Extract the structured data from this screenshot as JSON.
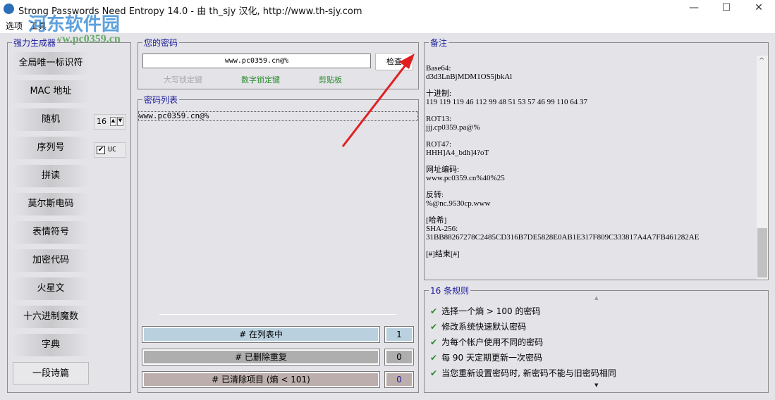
{
  "window": {
    "title": "Strong Passwords Need Entropy 14.0 - 由 th_sjy 汉化, http://www.th-sjy.com",
    "minimize": "—",
    "maximize": "☐",
    "close": "✕"
  },
  "watermark": {
    "name": "河东软件园",
    "url": "www.pc0359.cn"
  },
  "menu": [
    "选项",
    "工具"
  ],
  "generator": {
    "title": "强力生成器",
    "buttons": [
      "全局唯一标识符",
      "MAC 地址",
      "随机",
      "序列号",
      "拼读",
      "莫尔斯电码",
      "表情符号",
      "加密代码",
      "火星文",
      "十六进制魔数",
      "字典",
      "一段诗篇"
    ],
    "length": "16",
    "uc_label": "UC",
    "uc_checked": true
  },
  "password": {
    "title": "您的密码",
    "value": "www.pc0359.cn@%",
    "check": "检查",
    "caps": "大写锁定键",
    "num": "数字锁定键",
    "clip": "剪贴板"
  },
  "list": {
    "title": "密码列表",
    "items": [
      "www.pc0359.cn@%"
    ],
    "stats": [
      {
        "label": "# 在列表中",
        "count": "1"
      },
      {
        "label": "# 已删除重复",
        "count": "0"
      },
      {
        "label": "# 已清除项目 (熵 < 101)",
        "count": "0"
      }
    ]
  },
  "notes": {
    "title": "备注",
    "text": "Base64:\nd3d3LnBjMDM1OS5jbkAl\n\n十进制:\n119 119 119 46 112 99 48 51 53 57 46 99 110 64 37\n\nROT13:\njjj.cp0359.pa@%\n\nROT47:\nHHH]A4_bdh]4?oT\n\n网址编码:\nwww.pc0359.cn%40%25\n\n反转:\n%@nc.9530cp.www\n\n[哈希]\nSHA-256:\n31BB88267278C2485CD316B7DE5828E0AB1E317F809C333817A4A7FB461282AE\n\n[#]结束[#]"
  },
  "rules": {
    "title": "16 条规则",
    "items": [
      "选择一个熵 > 100 的密码",
      "修改系统快速默认密码",
      "为每个帐户使用不同的密码",
      "每 90 天定期更新一次密码",
      "当您重新设置密码时, 新密码不能与旧密码相同"
    ]
  },
  "colors": {
    "accent": "#1a1a9a",
    "check": "#2a8a2a",
    "arrow": "#e02020"
  }
}
